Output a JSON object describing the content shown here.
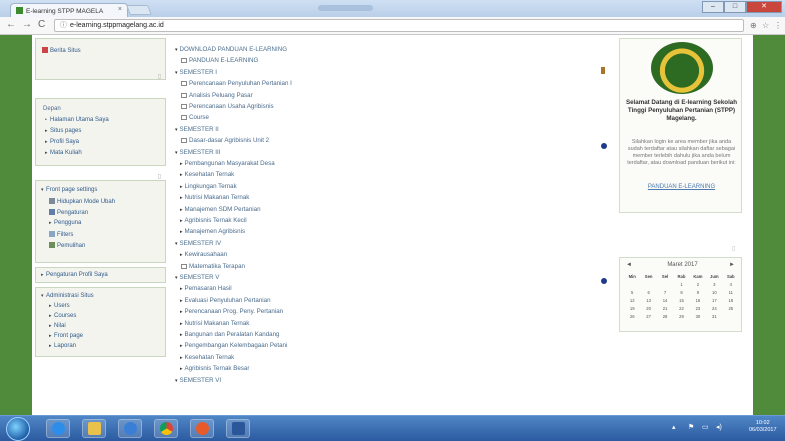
{
  "browser": {
    "tab_title": "E-learning STPP MAGELA",
    "tab_close": "×",
    "minimize": "–",
    "maximize": "□",
    "close": "✕",
    "url": "e-learning.stppmagelang.ac.id"
  },
  "left": {
    "block1": {
      "item": "Berita Situs"
    },
    "nav": {
      "title": "Depan",
      "items": [
        "Halaman Utama Saya",
        "Situs pages",
        "Profil Saya",
        "Mata Kuliah"
      ]
    },
    "settings": {
      "title": "Front page settings",
      "items": [
        "Hidupkan Mode Ubah",
        "Pengaturan",
        "Pengguna",
        "Filters",
        "Pemulihan"
      ]
    },
    "profile": {
      "item": "Pengaturan Profil Saya"
    },
    "admin": {
      "title": "Administrasi Situs",
      "items": [
        "Users",
        "Courses",
        "Nilai",
        "Front page",
        "Laporan"
      ]
    }
  },
  "main": {
    "lines": [
      {
        "text": "DOWNLOAD PANDUAN E-LEARNING",
        "kind": "sec"
      },
      {
        "text": "PANDUAN E-LEARNING",
        "kind": "sub"
      },
      {
        "text": "SEMESTER I",
        "kind": "sec"
      },
      {
        "text": "Perencanaan Penyuluhan Pertanian I",
        "kind": "sub"
      },
      {
        "text": "Analisis Peluang Pasar",
        "kind": "sub"
      },
      {
        "text": "Perencanaan Usaha Agribisnis",
        "kind": "sub"
      },
      {
        "text": "Course",
        "kind": "sub"
      },
      {
        "text": "SEMESTER II",
        "kind": "sec"
      },
      {
        "text": "Dasar-dasar Agribisnis Unit 2",
        "kind": "sub"
      },
      {
        "text": "SEMESTER III",
        "kind": "sec"
      },
      {
        "text": "Pembangunan Masyarakat Desa",
        "kind": "item"
      },
      {
        "text": "Kesehatan Ternak",
        "kind": "item"
      },
      {
        "text": "Lingkungan Ternak",
        "kind": "item"
      },
      {
        "text": "Nutrisi Makanan Ternak",
        "kind": "item"
      },
      {
        "text": "Manajemen SDM Pertanian",
        "kind": "item"
      },
      {
        "text": "Agribisnis Ternak Kecil",
        "kind": "item"
      },
      {
        "text": "Manajemen Agribisnis",
        "kind": "item"
      },
      {
        "text": "SEMESTER IV",
        "kind": "sec"
      },
      {
        "text": "Kewirausahaan",
        "kind": "item"
      },
      {
        "text": "Matematika Terapan",
        "kind": "sub"
      },
      {
        "text": "SEMESTER V",
        "kind": "sec"
      },
      {
        "text": "Pemasaran Hasil",
        "kind": "item"
      },
      {
        "text": "Evaluasi Penyuluhan Pertanian",
        "kind": "item"
      },
      {
        "text": "Perencanaan Prog. Peny. Pertanian",
        "kind": "item"
      },
      {
        "text": "Nutrisi Makanan Ternak",
        "kind": "item"
      },
      {
        "text": "Bangunan dan Peralatan Kandang",
        "kind": "item"
      },
      {
        "text": "Pengembangan Kelembagaan Petani",
        "kind": "item"
      },
      {
        "text": "Kesehatan Ternak",
        "kind": "item"
      },
      {
        "text": "Agribisnis Ternak Besar",
        "kind": "item"
      },
      {
        "text": "SEMESTER VI",
        "kind": "sec"
      }
    ]
  },
  "right": {
    "welcome": "Selamat Datang di E-learning Sekolah Tinggi Penyuluhan Pertanian (STPP) Magelang.",
    "note": "Silahkan login ke area member jika anda sudah terdaftar atau silahkan daftar sebagai member terlebih dahulu jika anda belum terdaftar, atau download panduan berikut ini:",
    "link": "PANDUAN E-LEARNING",
    "calendar": {
      "prev": "◄",
      "next": "►",
      "month": "Maret 2017",
      "days": [
        "Min",
        "Sen",
        "Sel",
        "Rab",
        "Kam",
        "Jum",
        "Sab"
      ],
      "cells": [
        "",
        "",
        "",
        "1",
        "2",
        "3",
        "4",
        "5",
        "6",
        "7",
        "8",
        "9",
        "10",
        "11",
        "12",
        "13",
        "14",
        "15",
        "16",
        "17",
        "18",
        "19",
        "20",
        "21",
        "22",
        "23",
        "24",
        "25",
        "26",
        "27",
        "28",
        "29",
        "30",
        "31",
        ""
      ]
    }
  },
  "taskbar": {
    "time": "10:02",
    "date": "06/03/2017"
  },
  "colors": {
    "page_bg": "#4f8b3a",
    "link": "#4a6b8c",
    "taskbar": "#2b5aa0"
  }
}
